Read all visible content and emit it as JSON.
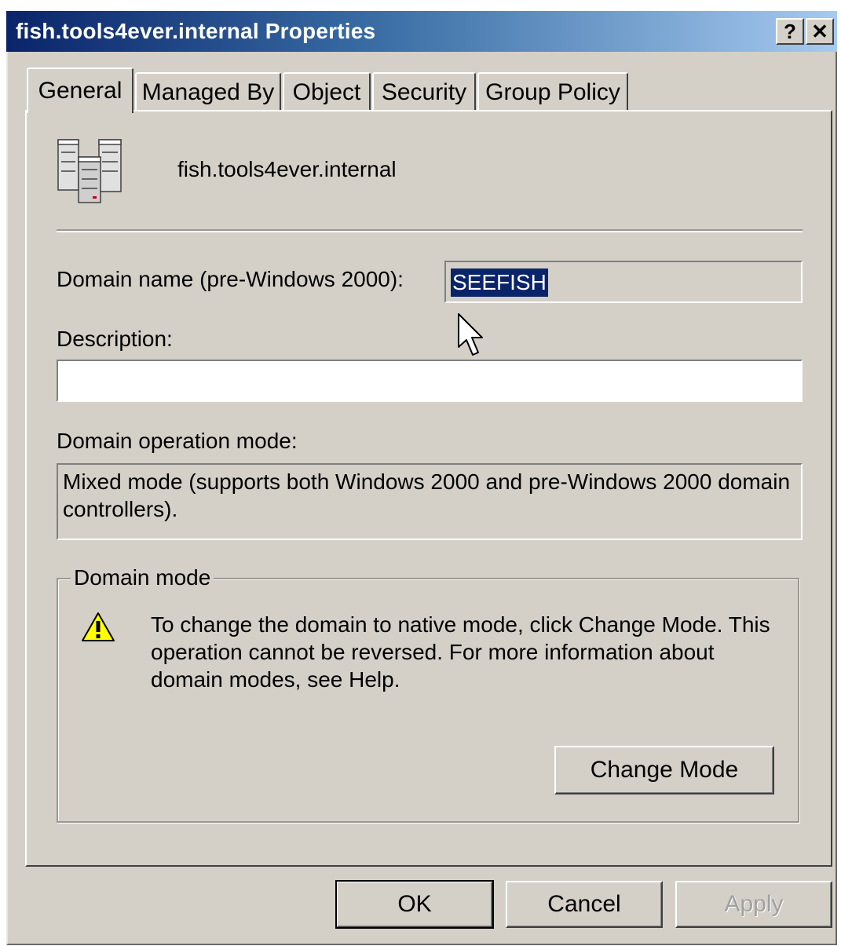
{
  "window": {
    "title": "fish.tools4ever.internal Properties",
    "help_label": "?",
    "close_label": "✕"
  },
  "tabs": [
    {
      "label": "General",
      "active": true
    },
    {
      "label": "Managed By",
      "active": false
    },
    {
      "label": "Object",
      "active": false
    },
    {
      "label": "Security",
      "active": false
    },
    {
      "label": "Group Policy",
      "active": false
    }
  ],
  "general": {
    "domain_icon": "domain-servers-icon",
    "domain_display_name": "fish.tools4ever.internal",
    "pre2000_label": "Domain name (pre-Windows 2000):",
    "pre2000_value": "SEEFISH",
    "description_label": "Description:",
    "description_value": "",
    "operation_mode_label": "Domain operation mode:",
    "operation_mode_value": "Mixed mode (supports both Windows 2000 and pre-Windows 2000 domain controllers).",
    "domain_mode_group": {
      "legend": "Domain mode",
      "warning_icon": "warning-icon",
      "warning_text": "To change the domain to native mode, click Change Mode. This operation cannot be reversed. For more information about domain modes, see Help.",
      "change_mode_label": "Change Mode"
    }
  },
  "footer": {
    "ok_label": "OK",
    "cancel_label": "Cancel",
    "apply_label": "Apply"
  },
  "colors": {
    "face": "#d4d0c8",
    "title_start": "#0a246a",
    "title_end": "#a6caf0",
    "selection": "#0a246a"
  }
}
